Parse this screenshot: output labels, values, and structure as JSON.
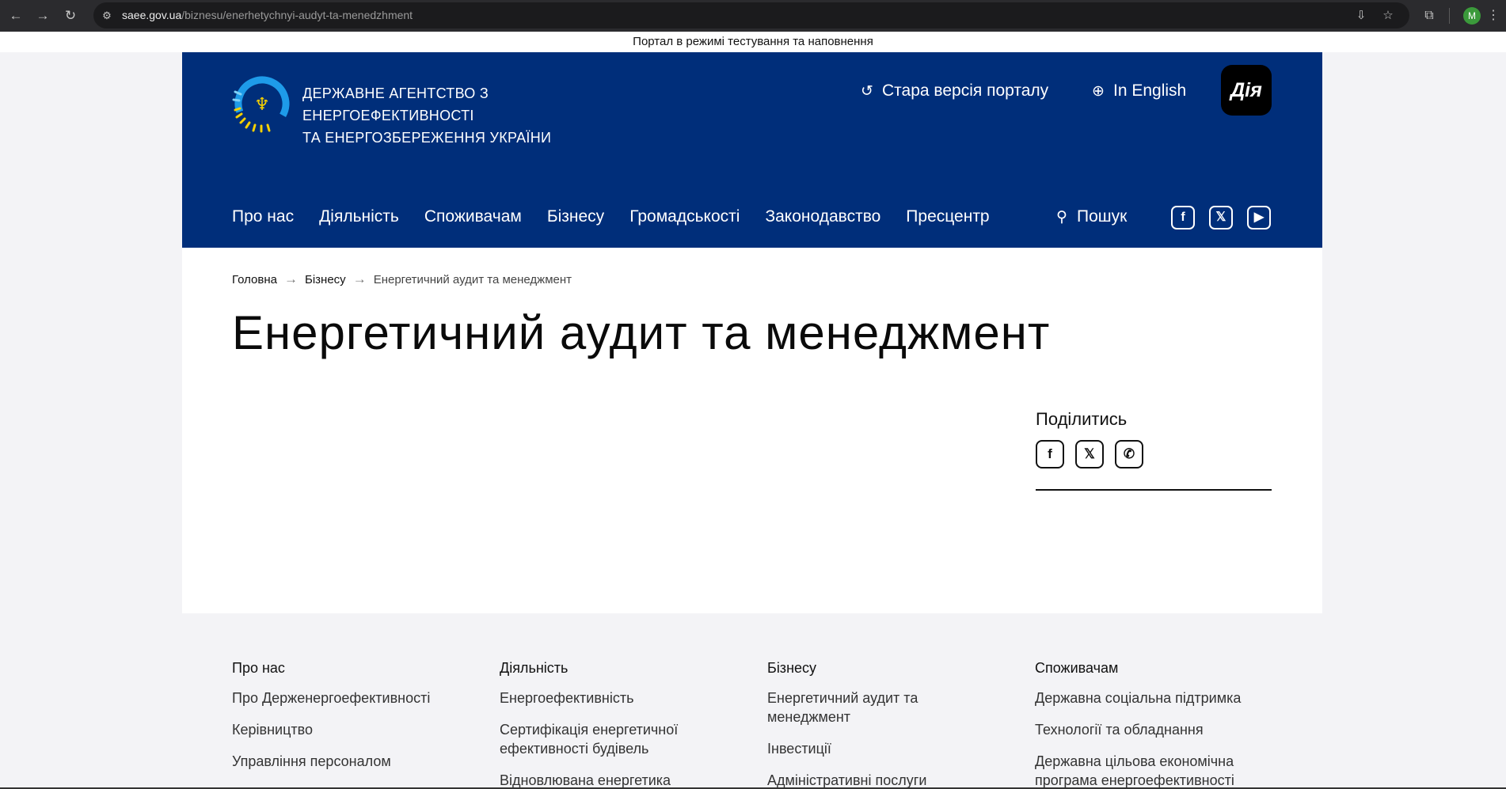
{
  "browser": {
    "url_host": "saee.gov.ua",
    "url_path": "/biznesu/enerhetychnyi-audyt-ta-menedzhment",
    "avatar_letter": "M"
  },
  "banner": {
    "text": "Портал в режимі тестування та наповнення"
  },
  "header": {
    "agency_line1": "ДЕРЖАВНЕ АГЕНТСТВО З ЕНЕРГОЕФЕКТИВНОСТІ",
    "agency_line2": "ТА ЕНЕРГОЗБЕРЕЖЕННЯ УКРАЇНИ",
    "old_version": "Стара версія порталу",
    "english": "In English",
    "diia": "Дія",
    "search": "Пошук",
    "nav": [
      {
        "label": "Про нас"
      },
      {
        "label": "Діяльність"
      },
      {
        "label": "Споживачам"
      },
      {
        "label": "Бізнесу"
      },
      {
        "label": "Громадськості"
      },
      {
        "label": "Законодавство"
      },
      {
        "label": "Пресцентр"
      }
    ],
    "colors": {
      "header_bg": "#002e7a",
      "accent_yellow": "#f5d000",
      "accent_blue": "#1e9be9"
    }
  },
  "breadcrumb": {
    "home": "Головна",
    "section": "Бізнесу",
    "current": "Енергетичний аудит та менеджмент"
  },
  "page": {
    "title": "Енергетичний аудит та менеджмент",
    "share_title": "Поділитись"
  },
  "footer": {
    "columns": [
      {
        "heading": "Про нас",
        "links": [
          "Про Держенергоефективності",
          "Керівництво",
          "Управління персоналом"
        ]
      },
      {
        "heading": "Діяльність",
        "links": [
          "Енергоефективність",
          "Сертифікація енергетичної ефективності будівель",
          "Відновлювана енергетика"
        ]
      },
      {
        "heading": "Бізнесу",
        "links": [
          "Енергетичний аудит та менеджмент",
          "Інвестиції",
          "Адміністративні послуги"
        ]
      },
      {
        "heading": "Споживачам",
        "links": [
          "Державна соціальна підтримка",
          "Технології та обладнання",
          "Державна цільова економічна програма енергоефективності"
        ]
      }
    ]
  }
}
